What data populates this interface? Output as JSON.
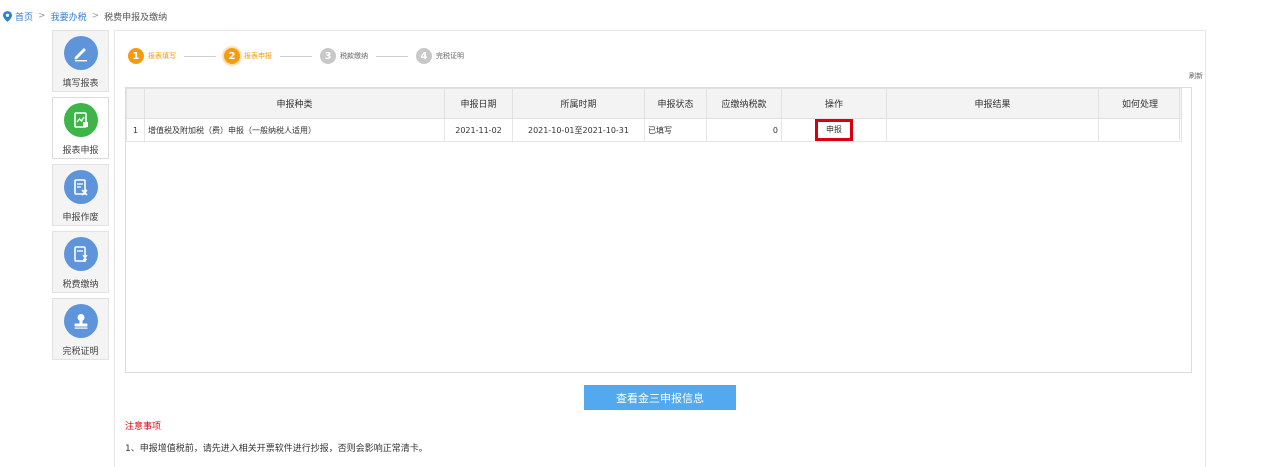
{
  "breadcrumb": {
    "home": "首页",
    "section": "我要办税",
    "current": "税费申报及缴纳",
    "separator": ">"
  },
  "sidebar": {
    "items": [
      {
        "label": "填写报表",
        "icon": "pencil-icon"
      },
      {
        "label": "报表申报",
        "icon": "report-chart-icon",
        "active": true
      },
      {
        "label": "申报作废",
        "icon": "void-document-icon"
      },
      {
        "label": "税费缴纳",
        "icon": "payment-document-icon"
      },
      {
        "label": "完税证明",
        "icon": "stamp-icon"
      }
    ]
  },
  "steps": [
    {
      "num": "1",
      "label": "报表填写",
      "state": "done"
    },
    {
      "num": "2",
      "label": "报表申报",
      "state": "current"
    },
    {
      "num": "3",
      "label": "税款缴纳",
      "state": "todo"
    },
    {
      "num": "4",
      "label": "完税证明",
      "state": "todo"
    }
  ],
  "toolbar": {
    "refresh": "刷新"
  },
  "table": {
    "columns": [
      "申报种类",
      "申报日期",
      "所属时期",
      "申报状态",
      "应缴纳税款",
      "操作",
      "申报结果",
      "如何处理"
    ],
    "rows": [
      {
        "index": "1",
        "type": "增值税及附加税（费）申报（一般纳税人适用）",
        "date": "2021-11-02",
        "period": "2021-10-01至2021-10-31",
        "status": "已填写",
        "amount": "0",
        "action": "申报",
        "result": "",
        "handle": ""
      }
    ]
  },
  "view_button": "查看金三申报信息",
  "notes": {
    "title": "注意事项",
    "items": [
      "1、申报增值税前，请先进入相关开票软件进行抄报，否则会影响正常清卡。"
    ]
  },
  "colors": {
    "accent": "#f39c12",
    "link": "#2f7fd1",
    "primary_button": "#52a9f0",
    "highlight_border": "#d9000d",
    "sidebar_icon_blue": "#5e94da",
    "sidebar_icon_green": "#3db549"
  }
}
